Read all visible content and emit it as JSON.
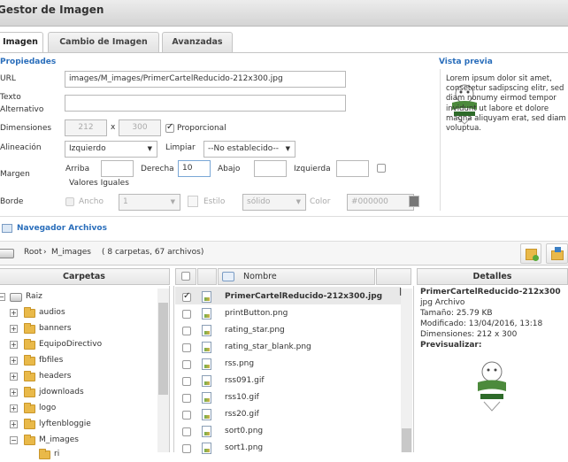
{
  "window": {
    "title": "Gestor de Imagen"
  },
  "tabs": [
    {
      "label": "Imagen",
      "active": true
    },
    {
      "label": "Cambio de Imagen",
      "active": false
    },
    {
      "label": "Avanzadas",
      "active": false
    }
  ],
  "properties": {
    "heading": "Propiedades",
    "url_label": "URL",
    "url_value": "images/M_images/PrimerCartelReducido-212x300.jpg",
    "alt_label_1": "Texto",
    "alt_label_2": "Alternativo",
    "alt_value": "",
    "dims_label": "Dimensiones",
    "width": "212",
    "times": "x",
    "height": "300",
    "proportional_label": "Proporcional",
    "align_label": "Alineación",
    "align_value": "Izquierdo",
    "clear_label": "Limpiar",
    "clear_value": "--No establecido--",
    "margin_label": "Margen",
    "top_label": "Arriba",
    "top_value": "",
    "right_label": "Derecha",
    "right_value": "10",
    "bottom_label": "Abajo",
    "bottom_value": "",
    "left_label": "Izquierda",
    "left_value": "",
    "equal_label": "Valores Iguales",
    "border_label": "Borde",
    "border_width_label": "Ancho",
    "border_width_value": "1",
    "border_style_label": "Estilo",
    "border_style_value": "sólido",
    "border_color_label": "Color",
    "border_color_value": "#000000"
  },
  "preview": {
    "heading": "Vista previa",
    "text": "Lorem ipsum dolor sit amet, consetetur sadipscing elitr, sed diam nonumy eirmod tempor invidunt ut labore et dolore magna aliquyam erat, sed diam voluptua."
  },
  "navigator": {
    "heading": "Navegador Archivos",
    "path_root": "Root",
    "path_sep": "›",
    "path_folder": "M_images",
    "summary": "( 8 carpetas, 67 archivos)"
  },
  "folders": {
    "header": "Carpetas",
    "root": "Raiz",
    "items": [
      "audios",
      "banners",
      "EquipoDirectivo",
      "fbfiles",
      "headers",
      "jdownloads",
      "logo",
      "lyftenbloggie",
      "M_images"
    ],
    "partial_child": "ri"
  },
  "files": {
    "header": "Nombre",
    "items": [
      {
        "name": "PrimerCartelReducido-212x300.jpg",
        "selected": true
      },
      {
        "name": "printButton.png",
        "selected": false
      },
      {
        "name": "rating_star.png",
        "selected": false
      },
      {
        "name": "rating_star_blank.png",
        "selected": false
      },
      {
        "name": "rss.png",
        "selected": false
      },
      {
        "name": "rss091.gif",
        "selected": false
      },
      {
        "name": "rss10.gif",
        "selected": false
      },
      {
        "name": "rss20.gif",
        "selected": false
      },
      {
        "name": "sort0.png",
        "selected": false
      },
      {
        "name": "sort1.png",
        "selected": false
      }
    ]
  },
  "details": {
    "header": "Detalles",
    "name": "PrimerCartelReducido-212x300",
    "type": "jpg Archivo",
    "size": "Tamaño: 25.79 KB",
    "modified": "Modificado: 13/04/2016, 13:18",
    "dims": "Dimensiones: 212 x 300",
    "preview_label": "Previsualizar:"
  },
  "colors": {
    "accent": "#2a6ebb",
    "folder": "#e9b949",
    "highlight": "#e8e8e8"
  }
}
